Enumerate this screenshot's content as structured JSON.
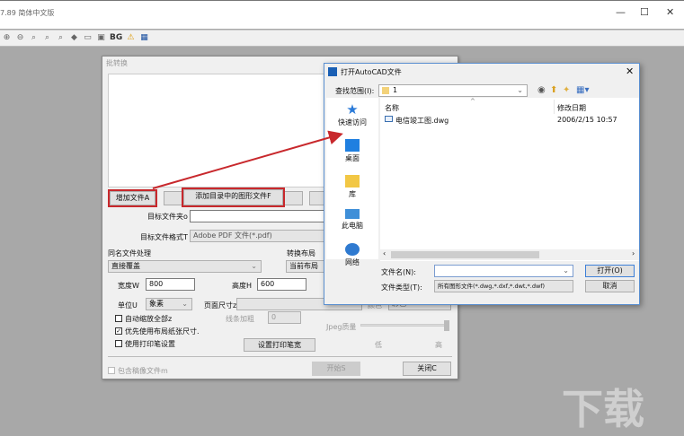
{
  "app": {
    "title": "7.89 简体中文版",
    "toolbar_text": "BG"
  },
  "batch": {
    "title": "批转换",
    "add_file": "增加文件A",
    "add_dir": "添加目录中的图形文件F",
    "target_folder_label": "目标文件夹o",
    "target_folder_value": "",
    "target_format_label": "目标文件格式T",
    "target_format_value": "Adobe PDF 文件(*.pdf)",
    "same_name_label": "同名文件处理",
    "same_name_value": "直接覆盖",
    "layout_label": "转换布局",
    "layout_value": "当前布局",
    "width_label": "宽度W",
    "width_value": "800",
    "height_label": "高度H",
    "height_value": "600",
    "unit_label": "单位U",
    "unit_value": "象素",
    "page_size_label": "页面尺寸z",
    "page_size_value": "",
    "color_label": "颜色",
    "color_value": "彩色",
    "auto_zoom": "自动缩放全部z",
    "auto_zoom_checked": false,
    "line_bold_label": "线条加粗",
    "line_bold_value": "0",
    "prefer_layout": "优先使用布局纸张尺寸.",
    "prefer_layout_checked": true,
    "use_pen": "使用打印笔设置",
    "use_pen_checked": false,
    "set_pen": "设置打印笔宽",
    "jpeg_label": "Jpeg质量",
    "jpeg_low": "低",
    "jpeg_high": "高",
    "jpeg_quality": 1.0,
    "include_xref": "包含稿像文件m",
    "start": "开始S",
    "close": "关闭C"
  },
  "open_dialog": {
    "title": "打开AutoCAD文件",
    "look_in_label": "查找范围(I):",
    "look_in_value": "1",
    "nav": [
      "快速访问",
      "桌面",
      "库",
      "此电脑",
      "网络"
    ],
    "columns": [
      "名称",
      "修改日期"
    ],
    "files": [
      {
        "name": "电信竣工图.dwg",
        "date": "2006/2/15 10:57"
      }
    ],
    "filename_label": "文件名(N):",
    "filename_value": "",
    "filetype_label": "文件类型(T):",
    "filetype_value": "所有图形文件(*.dwg,*.dxf,*.dwt,*.dwf)",
    "open": "打开(O)",
    "cancel": "取消"
  }
}
